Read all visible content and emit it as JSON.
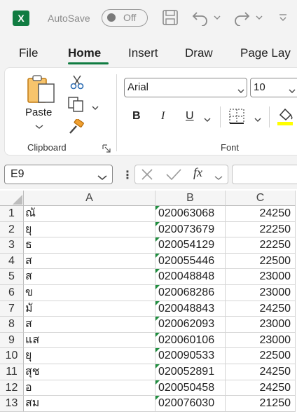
{
  "titlebar": {
    "app_icon_letter": "X",
    "autosave_label": "AutoSave",
    "autosave_state": "Off"
  },
  "tabs": [
    "File",
    "Home",
    "Insert",
    "Draw",
    "Page Lay"
  ],
  "ribbon": {
    "paste_label": "Paste",
    "clipboard_label": "Clipboard",
    "font_name": "Arial",
    "font_size": "10",
    "bold": "B",
    "italic": "I",
    "underline": "U",
    "font_label": "Font"
  },
  "formula_bar": {
    "name_box": "E9",
    "fx": "fx"
  },
  "columns": [
    "A",
    "B",
    "C"
  ],
  "rows": [
    {
      "n": "1",
      "a": "ณั",
      "b": "020063068",
      "c": "24250"
    },
    {
      "n": "2",
      "a": "ยุ",
      "b": "020073679",
      "c": "22250"
    },
    {
      "n": "3",
      "a": "ธ",
      "b": "020054129",
      "c": "22250"
    },
    {
      "n": "4",
      "a": "ส",
      "b": "020055446",
      "c": "22500"
    },
    {
      "n": "5",
      "a": "ส",
      "b": "020048848",
      "c": "23000"
    },
    {
      "n": "6",
      "a": "ข",
      "b": "020068286",
      "c": "23000"
    },
    {
      "n": "7",
      "a": "มั",
      "b": "020048843",
      "c": "24250"
    },
    {
      "n": "8",
      "a": "ส",
      "b": "020062093",
      "c": "23000"
    },
    {
      "n": "9",
      "a": "แส",
      "b": "020060106",
      "c": "23000"
    },
    {
      "n": "10",
      "a": "ยุ",
      "b": "020090533",
      "c": "22500"
    },
    {
      "n": "11",
      "a": "สุช",
      "b": "020052891",
      "c": "24250"
    },
    {
      "n": "12",
      "a": "อ",
      "b": "020050458",
      "c": "24250"
    },
    {
      "n": "13",
      "a": "สม",
      "b": "020076030",
      "c": "21250"
    }
  ],
  "colors": {
    "excel_green": "#107c41",
    "number_stored_as_text_marker": "#1e8e3e",
    "fill_color_swatch": "#ffff00"
  },
  "icons": [
    "excel-logo-icon",
    "save-icon",
    "undo-icon",
    "redo-icon",
    "customize-qat-icon",
    "paste-icon",
    "cut-icon",
    "copy-icon",
    "format-painter-icon",
    "borders-icon",
    "fill-color-icon",
    "cancel-icon",
    "enter-icon",
    "insert-function-icon"
  ]
}
